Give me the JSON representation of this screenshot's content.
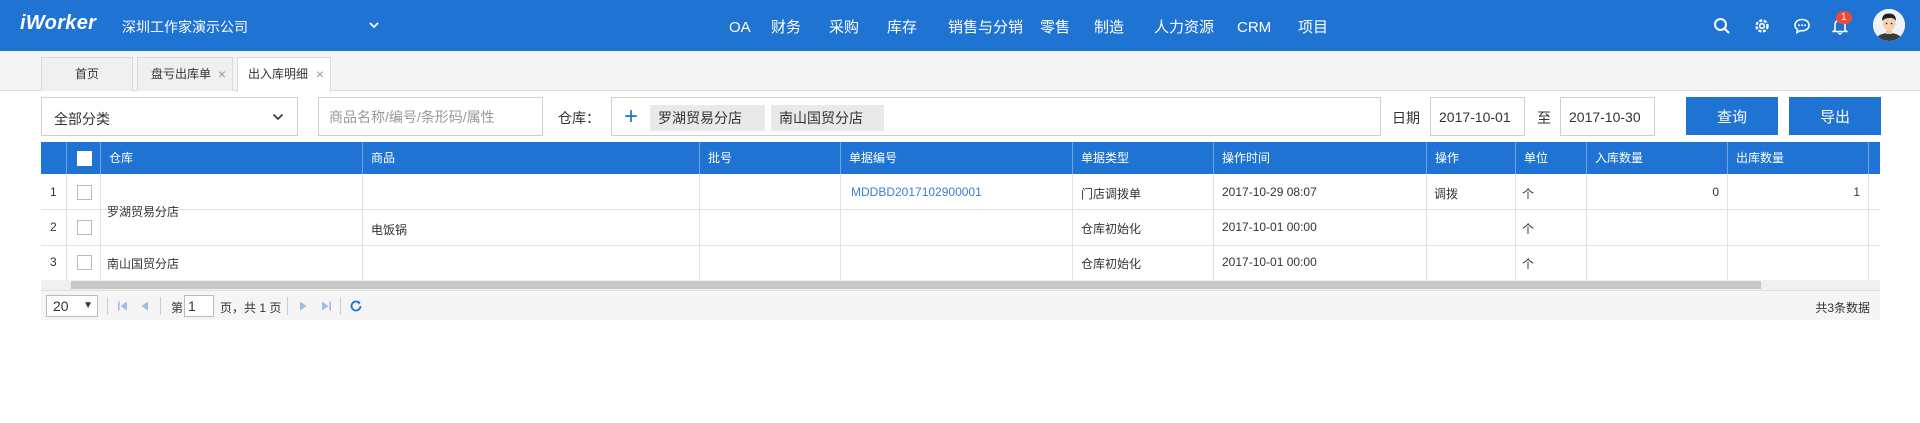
{
  "header": {
    "logo": "iWorker",
    "company": "深圳工作家演示公司",
    "nav": [
      "OA",
      "财务",
      "采购",
      "库存",
      "销售与分销",
      "零售",
      "制造",
      "人力资源",
      "CRM",
      "项目"
    ],
    "notification_count": "1",
    "accent_color": "#1f73d3"
  },
  "tabs": [
    {
      "label": "首页"
    },
    {
      "label": "盘亏出库单"
    },
    {
      "label": "出入库明细"
    }
  ],
  "filters": {
    "category": "全部分类",
    "search_placeholder": "商品名称/编号/条形码/属性",
    "warehouse_label": "仓库：",
    "warehouses": [
      "罗湖贸易分店",
      "南山国贸分店"
    ],
    "date_label": "日期",
    "date_from": "2017-10-01",
    "date_sep": "至",
    "date_to": "2017-10-30",
    "query_button": "查询",
    "export_button": "导出"
  },
  "table": {
    "columns": [
      "仓库",
      "商品",
      "批号",
      "单据编号",
      "单据类型",
      "操作时间",
      "操作",
      "单位",
      "入库数量",
      "出库数量"
    ],
    "rows": [
      {
        "no": "1",
        "warehouse": "罗湖贸易分店",
        "product": "电饭锅",
        "batch": "",
        "doc_no": "MDDBD2017102900001",
        "doc_type": "门店调拨单",
        "time": "2017-10-29 08:07",
        "op": "调拨",
        "unit": "个",
        "in_qty": "0",
        "out_qty": "1"
      },
      {
        "no": "2",
        "warehouse": "",
        "product": "",
        "batch": "",
        "doc_no": "",
        "doc_type": "仓库初始化",
        "time": "2017-10-01 00:00",
        "op": "",
        "unit": "个",
        "in_qty": "",
        "out_qty": ""
      },
      {
        "no": "3",
        "warehouse": "南山国贸分店",
        "product": "",
        "batch": "",
        "doc_no": "",
        "doc_type": "仓库初始化",
        "time": "2017-10-01 00:00",
        "op": "",
        "unit": "个",
        "in_qty": "",
        "out_qty": ""
      }
    ]
  },
  "pager": {
    "page_size": "20",
    "page_prefix": "第",
    "current_page": "1",
    "page_suffix": "页，共 1 页",
    "total": "共3条数据"
  }
}
